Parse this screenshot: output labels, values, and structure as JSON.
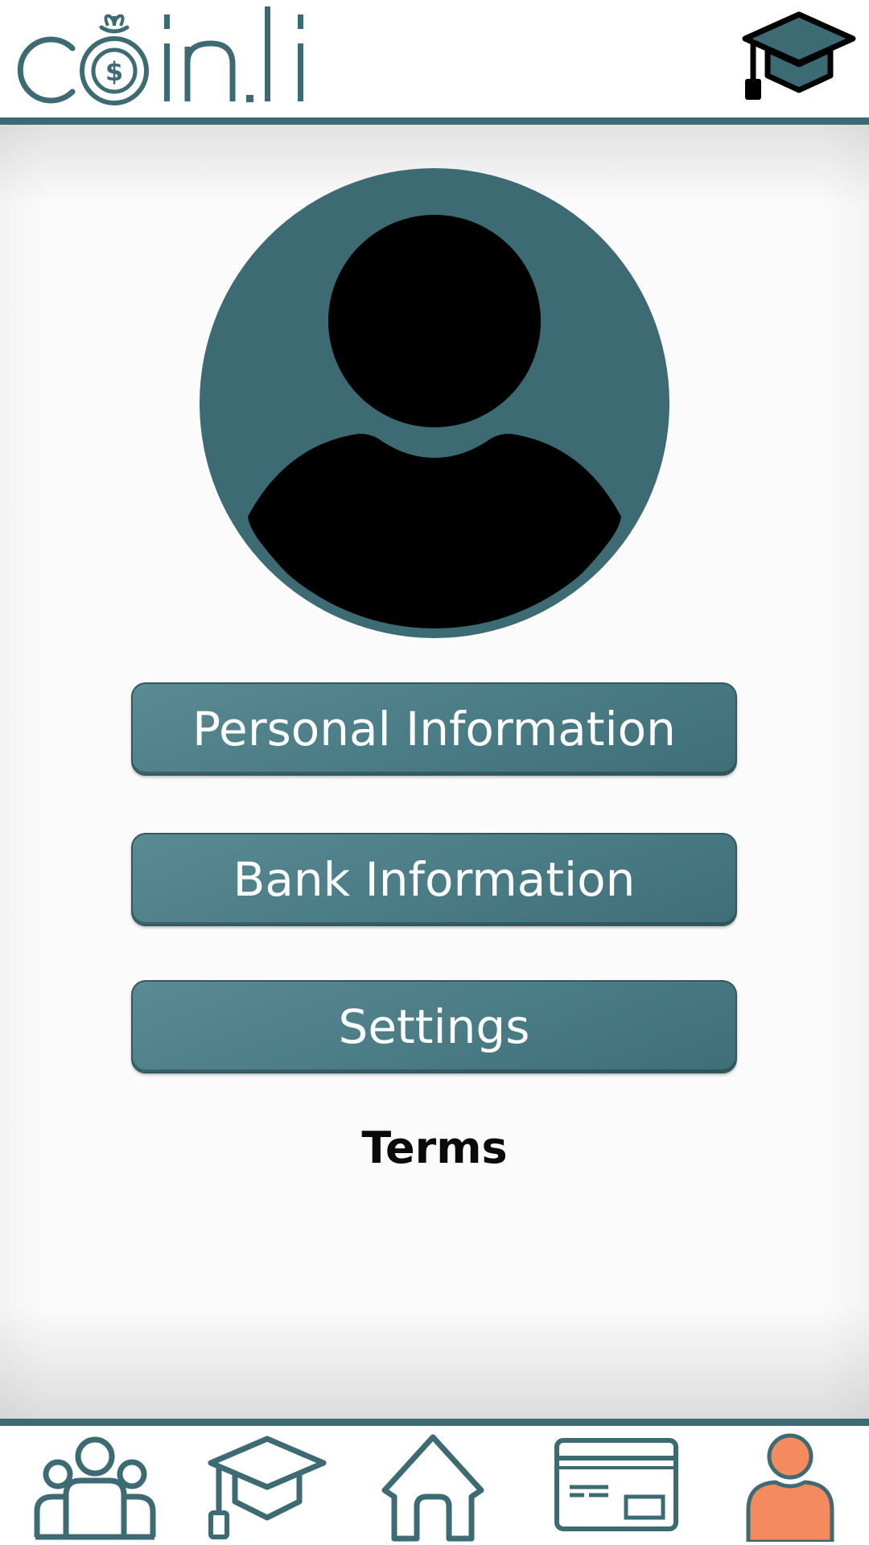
{
  "header": {
    "logo_text": "coin.li",
    "logo_icon": "money-bag-icon",
    "right_icon": "graduation-cap-icon"
  },
  "profile": {
    "avatar_icon": "user-avatar-icon"
  },
  "menu": {
    "personal_information": "Personal Information",
    "bank_information": "Bank Information",
    "settings": "Settings",
    "terms": "Terms"
  },
  "bottom_nav": {
    "items": [
      {
        "icon": "community-icon",
        "active": false
      },
      {
        "icon": "graduation-cap-icon",
        "active": false
      },
      {
        "icon": "home-icon",
        "active": false
      },
      {
        "icon": "credit-card-icon",
        "active": false
      },
      {
        "icon": "profile-icon",
        "active": true
      }
    ]
  },
  "colors": {
    "brand_teal": "#3d6b73",
    "active_orange": "#f48a5e",
    "avatar_fill": "#000000",
    "button_text": "#ffffff"
  }
}
